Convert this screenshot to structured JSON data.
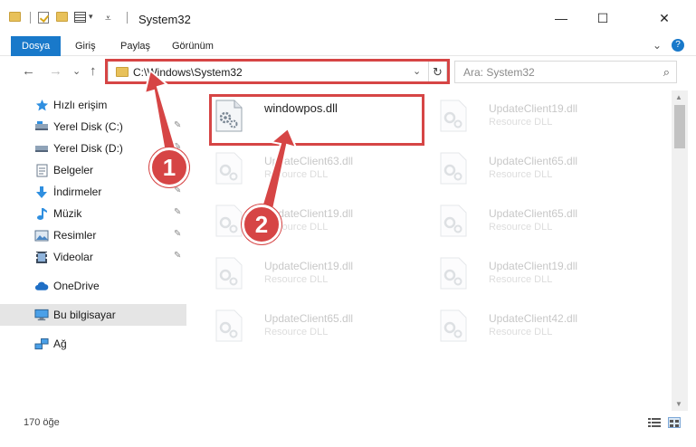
{
  "window": {
    "title": "System32",
    "minimize_glyph": "—",
    "maximize_glyph": "☐",
    "close_glyph": "✕"
  },
  "ribbon": {
    "tabs": [
      {
        "label": "Dosya",
        "active": true
      },
      {
        "label": "Giriş",
        "active": false
      },
      {
        "label": "Paylaş",
        "active": false
      },
      {
        "label": "Görünüm",
        "active": false
      }
    ],
    "expand_glyph": "⌄",
    "help_glyph": "?"
  },
  "nav": {
    "back_glyph": "←",
    "forward_glyph": "→",
    "recent_glyph": "⌄",
    "up_glyph": "↑",
    "address": "C:\\Windows\\System32",
    "address_chevron": "⌄",
    "refresh_glyph": "↻",
    "search_placeholder": "Ara: System32",
    "search_glyph": "⌕"
  },
  "sidebar": {
    "items": [
      {
        "label": "Hızlı erişim",
        "icon": "star-icon",
        "pinned": false
      },
      {
        "label": "Yerel Disk (C:)",
        "icon": "drive-icon",
        "pinned": true
      },
      {
        "label": "Yerel Disk (D:)",
        "icon": "drive-icon",
        "pinned": true
      },
      {
        "label": "Belgeler",
        "icon": "document-icon",
        "pinned": true
      },
      {
        "label": "İndirmeler",
        "icon": "download-icon",
        "pinned": true
      },
      {
        "label": "Müzik",
        "icon": "music-icon",
        "pinned": true
      },
      {
        "label": "Resimler",
        "icon": "pictures-icon",
        "pinned": true
      },
      {
        "label": "Videolar",
        "icon": "video-icon",
        "pinned": true
      },
      {
        "label": "OneDrive",
        "icon": "cloud-icon",
        "pinned": false
      },
      {
        "label": "Bu bilgisayar",
        "icon": "computer-icon",
        "pinned": false,
        "selected": true
      },
      {
        "label": "Ağ",
        "icon": "network-icon",
        "pinned": false
      }
    ],
    "pin_glyph": "📌"
  },
  "files": [
    {
      "name": "windowpos.dll",
      "type": "",
      "highlighted": true
    },
    {
      "name": "UpdateClient19.dll",
      "type": "Resource DLL"
    },
    {
      "name": "UpdateClient63.dll",
      "type": "Resource DLL"
    },
    {
      "name": "UpdateClient65.dll",
      "type": "Resource DLL"
    },
    {
      "name": "UpdateClient19.dll",
      "type": "Resource DLL"
    },
    {
      "name": "UpdateClient65.dll",
      "type": "Resource DLL"
    },
    {
      "name": "UpdateClient19.dll",
      "type": "Resource DLL"
    },
    {
      "name": "UpdateClient19.dll",
      "type": "Resource DLL"
    },
    {
      "name": "UpdateClient65.dll",
      "type": "Resource DLL"
    },
    {
      "name": "UpdateClient42.dll",
      "type": "Resource DLL"
    }
  ],
  "status": {
    "item_count": "170 öğe"
  },
  "annotations": {
    "badge_1": "1",
    "badge_2": "2",
    "color": "#d64545"
  },
  "colors": {
    "accent": "#1979ca",
    "folder": "#e8c15a",
    "selection": "#e5e5e5"
  }
}
